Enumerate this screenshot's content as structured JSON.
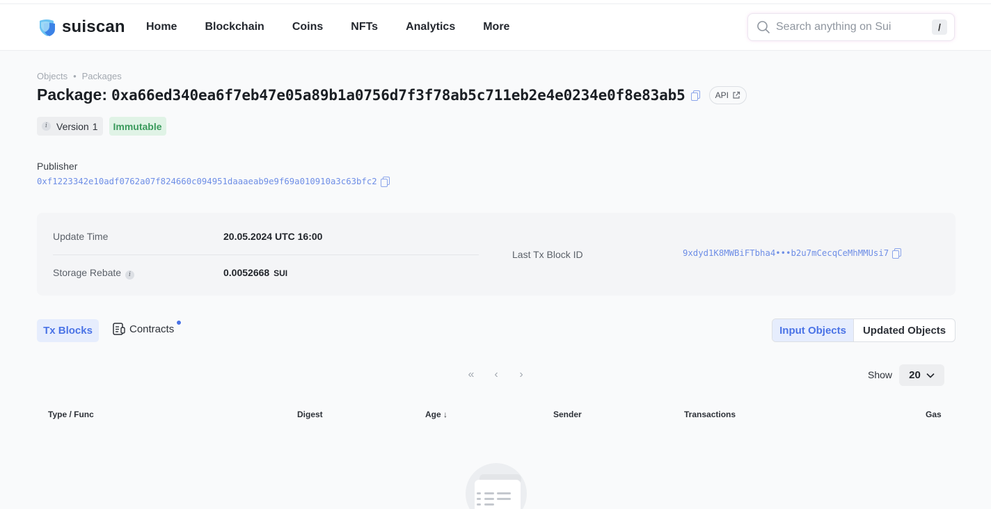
{
  "header": {
    "logo_text": "suiscan",
    "nav": [
      "Home",
      "Blockchain",
      "Coins",
      "NFTs",
      "Analytics",
      "More"
    ],
    "search_placeholder": "Search anything on Sui",
    "search_shortcut": "/"
  },
  "breadcrumb": [
    "Objects",
    "Packages"
  ],
  "package": {
    "title_label": "Package:",
    "id": "0xa66ed340ea6f7eb47e05a89b1a0756d7f3f78ab5c711eb2e4e0234e0f8e83ab5",
    "api_label": "API",
    "version_label": "Version",
    "version_value": "1",
    "status_badge": "Immutable"
  },
  "publisher": {
    "label": "Publisher",
    "address": "0xf1223342e10adf0762a07f824660c094951daaaeab9e9f69a010910a3c63bfc2"
  },
  "info": {
    "update_time_label": "Update Time",
    "update_time_value": "20.05.2024 UTC 16:00",
    "storage_rebate_label": "Storage Rebate",
    "storage_rebate_value": "0.0052668",
    "storage_rebate_unit": "SUI",
    "last_tx_label": "Last Tx Block ID",
    "last_tx_value": "9xdyd1K8MWBiFTbha4•••b2u7mCecqCeMhMMUsi7"
  },
  "tabs": {
    "tx_blocks": "Tx Blocks",
    "contracts": "Contracts",
    "input_objects": "Input Objects",
    "updated_objects": "Updated Objects"
  },
  "pagination": {
    "first": "«",
    "prev": "‹",
    "next": "›",
    "show_label": "Show",
    "page_size": "20"
  },
  "table": {
    "columns": [
      "Type / Func",
      "Digest",
      "Age ↓",
      "Sender",
      "Transactions",
      "Gas"
    ]
  },
  "colors": {
    "accent": "#4a73e6",
    "link": "#6e8ee6",
    "success_bg": "#e0f3e6",
    "success_text": "#3a9a5c"
  }
}
